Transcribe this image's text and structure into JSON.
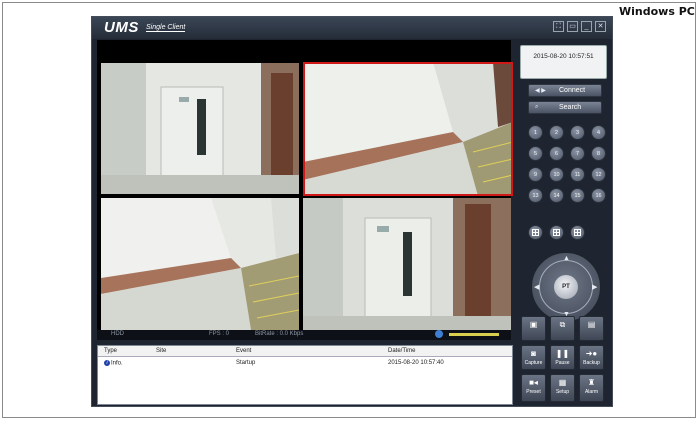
{
  "platform_label": "Windows PC",
  "app": {
    "logo": "UMS",
    "logo_sub": "Single Client",
    "window_buttons": [
      "fullscreen-icon",
      "restore-icon",
      "minimize-icon",
      "close-icon"
    ]
  },
  "clock": "2015-08-20 10:57:51",
  "connect_label": "Connect",
  "search_label": "Search",
  "channels": [
    "1",
    "2",
    "3",
    "4",
    "5",
    "6",
    "7",
    "8",
    "9",
    "10",
    "11",
    "12",
    "13",
    "14",
    "15",
    "16"
  ],
  "ptz_label": "PT",
  "status_bar": {
    "hdd": "HDD",
    "fps": "FPS : 0",
    "bitrate": "BitRate : 0.0 Kbps"
  },
  "event_log": {
    "columns": [
      "Type",
      "Site",
      "Event",
      "Date/Time"
    ],
    "rows": [
      {
        "type": "Info.",
        "site": "",
        "event": "Startup",
        "datetime": "2015-08-20 10:57:40"
      }
    ]
  },
  "function_buttons": [
    {
      "label": "",
      "icon": "camera-group-icon"
    },
    {
      "label": "",
      "icon": "camera-sequence-icon"
    },
    {
      "label": "",
      "icon": "camera-list-icon"
    },
    {
      "label": "Capture",
      "icon": "capture-icon"
    },
    {
      "label": "Pause",
      "icon": "pause-icon"
    },
    {
      "label": "Backup",
      "icon": "backup-icon"
    },
    {
      "label": "Preset",
      "icon": "preset-icon"
    },
    {
      "label": "Setup",
      "icon": "setup-icon"
    },
    {
      "label": "Alarm",
      "icon": "alarm-icon"
    }
  ],
  "colors": {
    "selected_border": "#d01818",
    "app_bg": "#1f2530"
  }
}
